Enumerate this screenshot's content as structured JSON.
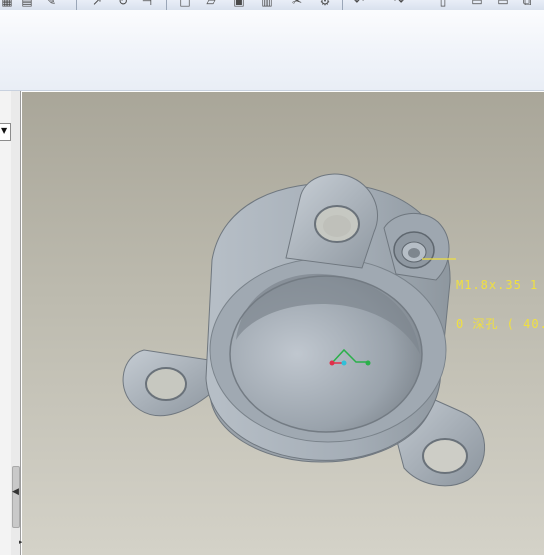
{
  "toolbar": {
    "icons": [
      "table-icon",
      "edit-icon",
      "move-icon",
      "rotate-icon",
      "align-icon",
      "new-icon",
      "folder-icon",
      "save-icon",
      "print-icon",
      "cut-icon",
      "tool-icon",
      "undo-icon",
      "redo-icon",
      "sheet-icon",
      "page-icon",
      "copy-icon"
    ]
  },
  "viewport": {
    "annotation_line1": "M1.8x.35 1",
    "annotation_line2": "0 深孔 ( 40.4"
  },
  "colors": {
    "annotation": "#f0e040",
    "model": "#a7b0b8",
    "background_top": "#a9a699",
    "background_bottom": "#d4d2c8"
  }
}
